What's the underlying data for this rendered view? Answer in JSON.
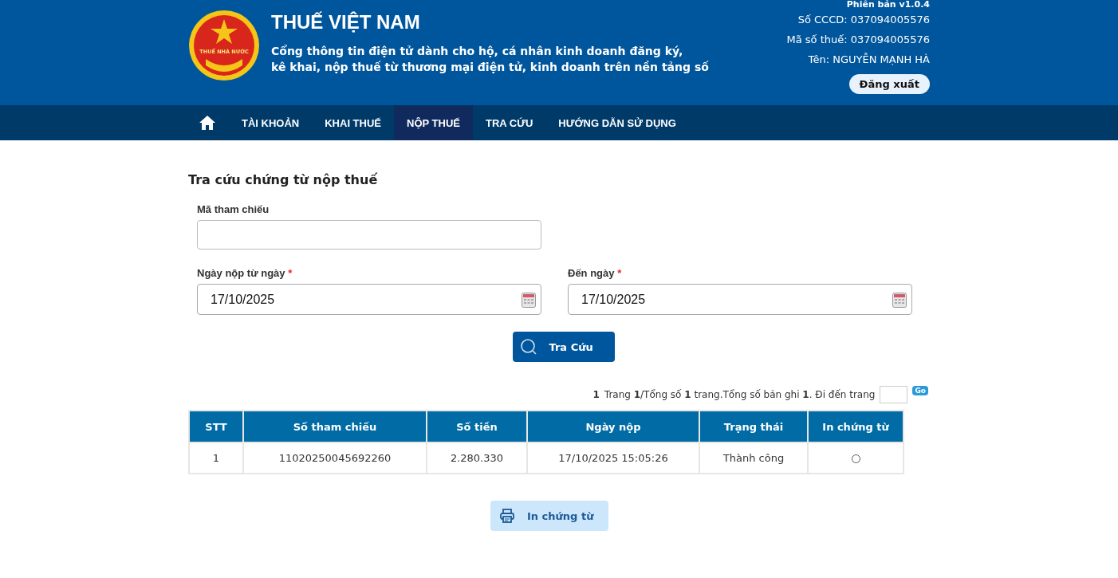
{
  "header": {
    "logo_text": "THUẾ NHÀ NƯỚC",
    "title": "THUẾ VIỆT NAM",
    "subtitle_lines": [
      "Cổng thông tin điện tử dành cho hộ, cá nhân kinh doanh đăng ký,",
      "kê khai, nộp thuế từ thương mại điện tử, kinh doanh trên nền tảng số"
    ],
    "user_info": [
      "Phiên bản v1.0.4",
      "Số CCCD: 037094005576",
      "Mã số thuế: 037094005576",
      "Tên: NGUYỄN MẠNH HÀ"
    ],
    "logout_button": "Đăng xuất"
  },
  "nav": {
    "items": [
      {
        "label": "TÀI KHOẢN",
        "selected": false
      },
      {
        "label": "KHAI THUẾ",
        "selected": false
      },
      {
        "label": "NỘP THUẾ",
        "selected": true
      },
      {
        "label": "TRA CỨU",
        "selected": false
      },
      {
        "label": "HƯỚNG DẪN SỬ DỤNG",
        "selected": false
      }
    ]
  },
  "page_title": "Tra cứu chứng từ nộp thuế",
  "form": {
    "reference": {
      "label": "Mã tham chiếu"
    },
    "from_date": {
      "label": "Ngày nộp từ ngày",
      "required_mark": "*",
      "value": "17/10/2025"
    },
    "to_date": {
      "label": "Đến ngày",
      "required_mark": "*",
      "value": "17/10/2025"
    },
    "search_button": "Tra Cứu"
  },
  "pagination": {
    "current": "1",
    "summary": "Trang **1**/Tổng số **1** trang.Tổng số bản ghi **1**. Đi đến trang",
    "go_button": "Go"
  },
  "table": {
    "columns": [
      "STT",
      "Số tham chiếu",
      "Số tiền",
      "Ngày nộp",
      "Trạng thái",
      "In chứng từ"
    ],
    "rows": [
      {
        "cells": [
          "1",
          "11020250045692260",
          "2.280.330",
          "17/10/2025 15:05:26",
          "Thành công"
        ],
        "selected": false
      }
    ]
  },
  "print_button": "In chứng từ"
}
